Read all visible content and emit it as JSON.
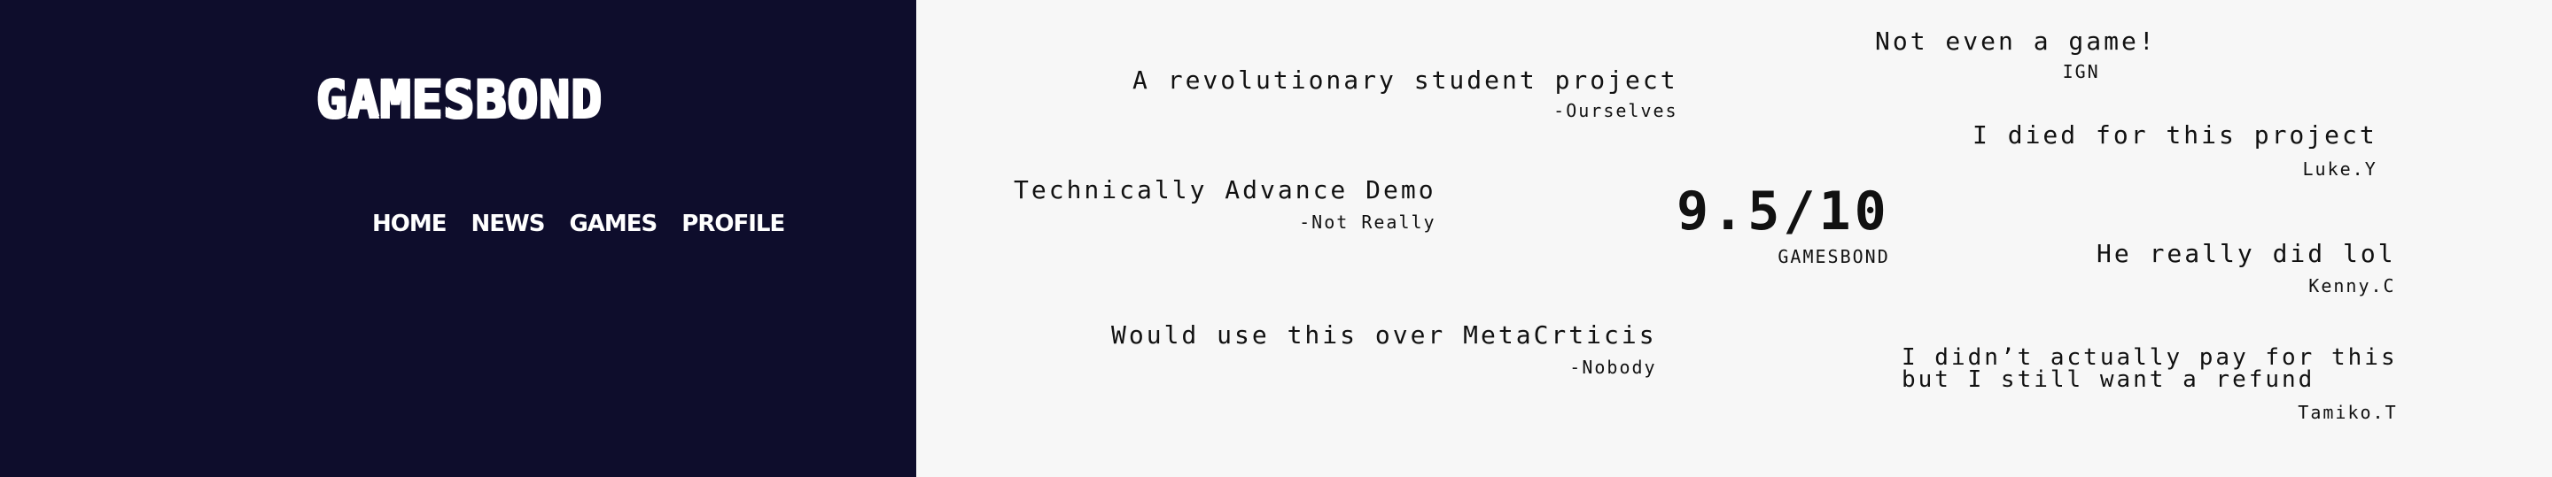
{
  "brand": {
    "logo": "GAMESBOND"
  },
  "nav": {
    "items": [
      "HOME",
      "NEWS",
      "GAMES",
      "PROFILE"
    ]
  },
  "score": {
    "value": "9.5/10",
    "source": "GAMESBOND"
  },
  "reviews": [
    {
      "quote": "A revolutionary student project",
      "author": "-Ourselves"
    },
    {
      "quote": "Not even a game!",
      "author": "IGN"
    },
    {
      "quote": "I died for this project",
      "author": "Luke.Y"
    },
    {
      "quote": "Technically Advance Demo",
      "author": "-Not Really"
    },
    {
      "quote": "He really did lol",
      "author": "Kenny.C"
    },
    {
      "quote": "Would use this over MetaCrticis",
      "author": "-Nobody"
    },
    {
      "quote": "I didn’t actually pay for this\nbut I still want a refund",
      "author": "Tamiko.T"
    }
  ]
}
